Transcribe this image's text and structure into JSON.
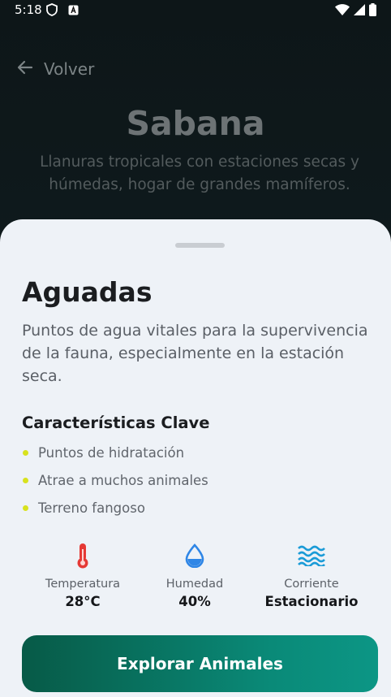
{
  "status_bar": {
    "time": "5:18"
  },
  "nav": {
    "back_label": "Volver"
  },
  "hero": {
    "title": "Sabana",
    "subtitle": "Llanuras tropicales con estaciones secas y húmedas, hogar de grandes mamíferos."
  },
  "sheet": {
    "title": "Aguadas",
    "description": "Puntos de agua vitales para la supervivencia de la fauna, especialmente en la estación seca.",
    "features_heading": "Características Clave",
    "features": [
      "Puntos de hidratación",
      "Atrae a muchos animales",
      "Terreno fangoso"
    ],
    "stats": [
      {
        "icon": "thermometer-icon",
        "label": "Temperatura",
        "value": "28°C",
        "color": "#e53935"
      },
      {
        "icon": "water-drop-icon",
        "label": "Humedad",
        "value": "40%",
        "color": "#2f86e6"
      },
      {
        "icon": "waves-icon",
        "label": "Corriente",
        "value": "Estacionario",
        "color": "#1a9bd7"
      }
    ],
    "cta_label": "Explorar Animales"
  },
  "colors": {
    "accent_dark": "#075a47",
    "accent_light": "#0c9685",
    "bullet": "#d8e21e",
    "sheet_bg": "#eef2f7"
  }
}
